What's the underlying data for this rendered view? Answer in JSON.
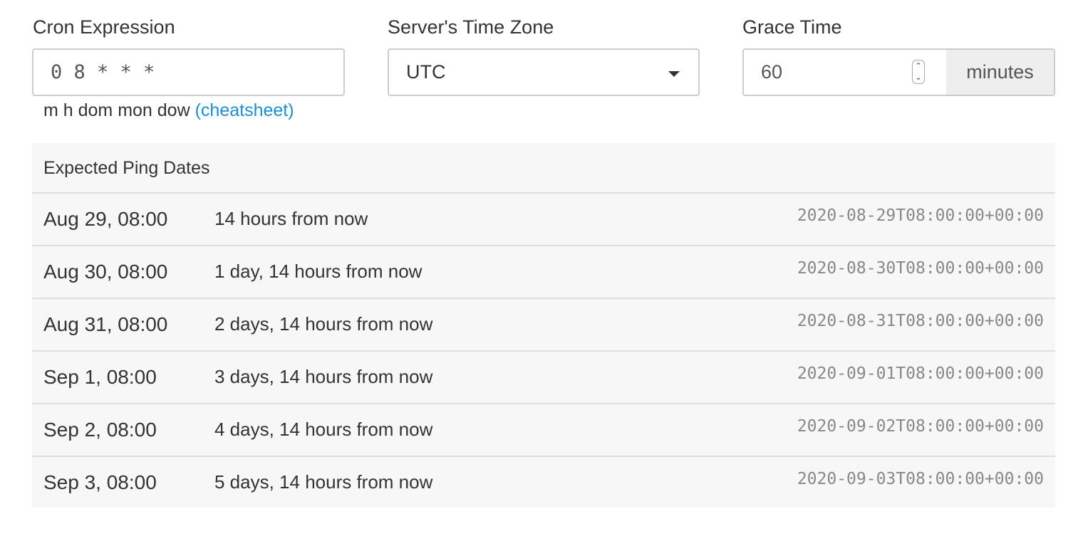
{
  "cron": {
    "label": "Cron Expression",
    "value": "0 8 * * *",
    "help_text": "m h dom mon dow",
    "cheatsheet_link": "(cheatsheet)"
  },
  "timezone": {
    "label": "Server's Time Zone",
    "value": "UTC"
  },
  "grace": {
    "label": "Grace Time",
    "value": "60",
    "unit": "minutes"
  },
  "pings": {
    "title": "Expected Ping Dates",
    "rows": [
      {
        "date": "Aug 29, 08:00",
        "relative": "14 hours from now",
        "iso": "2020-08-29T08:00:00+00:00"
      },
      {
        "date": "Aug 30, 08:00",
        "relative": "1 day, 14 hours from now",
        "iso": "2020-08-30T08:00:00+00:00"
      },
      {
        "date": "Aug 31, 08:00",
        "relative": "2 days, 14 hours from now",
        "iso": "2020-08-31T08:00:00+00:00"
      },
      {
        "date": "Sep 1, 08:00",
        "relative": "3 days, 14 hours from now",
        "iso": "2020-09-01T08:00:00+00:00"
      },
      {
        "date": "Sep 2, 08:00",
        "relative": "4 days, 14 hours from now",
        "iso": "2020-09-02T08:00:00+00:00"
      },
      {
        "date": "Sep 3, 08:00",
        "relative": "5 days, 14 hours from now",
        "iso": "2020-09-03T08:00:00+00:00"
      }
    ]
  }
}
